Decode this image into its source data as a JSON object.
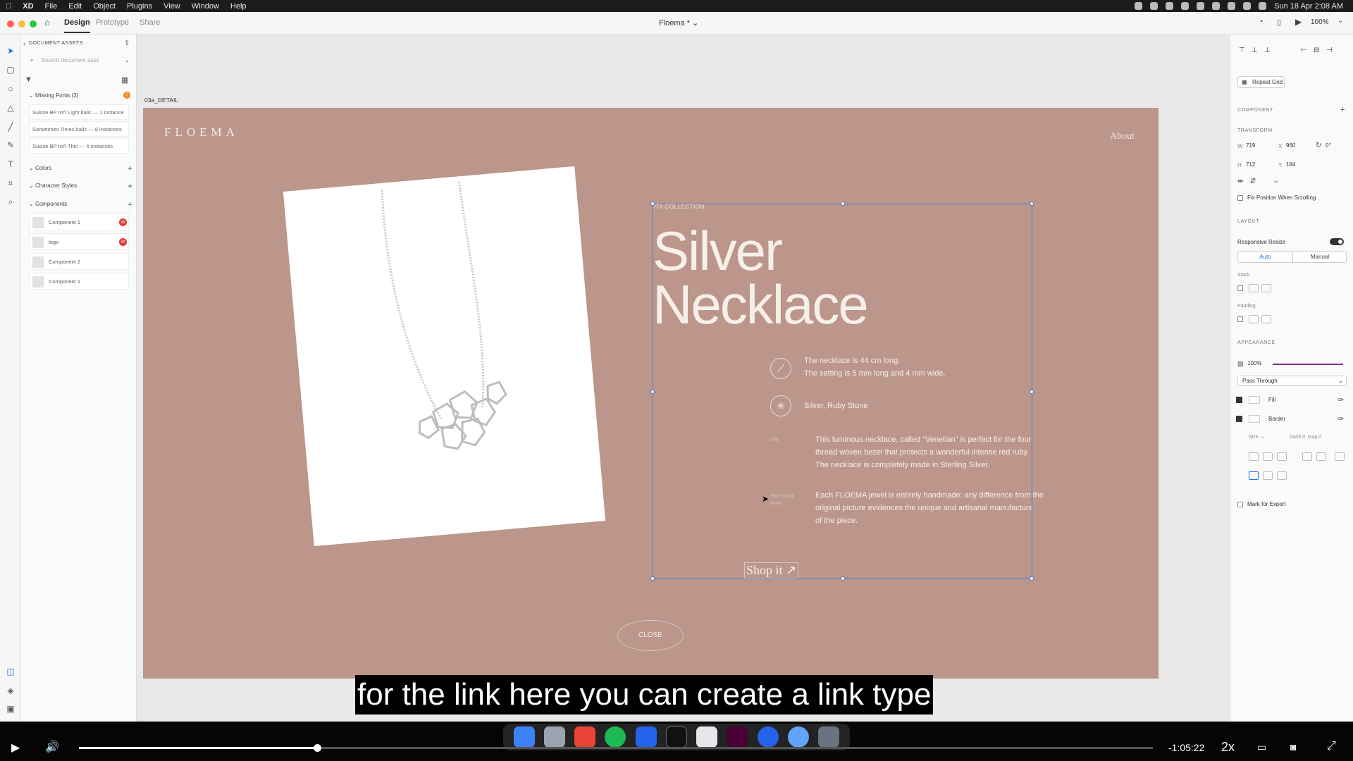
{
  "menubar": {
    "items": [
      "XD",
      "File",
      "Edit",
      "Object",
      "Plugins",
      "View",
      "Window",
      "Help"
    ],
    "datetime": "Sun 18 Apr 2:08 AM"
  },
  "titlebar": {
    "tabs": [
      "Design",
      "Prototype",
      "Share"
    ],
    "active_tab": "Design",
    "document_title": "Floema *",
    "zoom": "100%"
  },
  "assets": {
    "header": "DOCUMENT ASSETS",
    "search_placeholder": "Search document asse",
    "missing_fonts_label": "Missing Fonts (3)",
    "missing_fonts": [
      "Suisse BP Int'l Light Italic — 1 instance",
      "Sometimes Times Italic — 8 instances",
      "Suisse BP Int'l Thin — 4 instances"
    ],
    "sections": {
      "colors": "Colors",
      "character_styles": "Character Styles",
      "components": "Components"
    },
    "components": [
      {
        "name": "Component 1",
        "warning": true
      },
      {
        "name": "logo",
        "warning": true
      },
      {
        "name": "Component 2",
        "warning": false
      },
      {
        "name": "Component 1",
        "warning": false
      }
    ]
  },
  "canvas": {
    "artboard_name": "03a_DETAIL",
    "logo": "FLOEMA",
    "nav_about": "About",
    "collection": "ITA COLLECTION",
    "title_line1": "Silver",
    "title_line2": "Necklace",
    "size_line1": "The necklace is 44 cm long.",
    "size_line2": "The setting is 5 mm long and 4 mm wide.",
    "material": "Silver, Ruby Stone",
    "info_label": "Info",
    "info_lines": [
      "This luminous necklace, called “Venetian” is perfect for the four",
      "thread woven bezel that protects a wonderful intense red ruby.",
      "The necklace is completely made in Sterling Silver."
    ],
    "know_label_1": "You should",
    "know_label_2": "know",
    "know_lines": [
      "Each FLOEMA jewel is entirely handmade: any difference from the",
      "original picture evidences the unique and artisanal manufacture",
      "of the piece."
    ],
    "shop_label": "Shop it ↗",
    "close_label": "CLOSE",
    "background_color": "#bc968a"
  },
  "properties": {
    "repeat_grid": "Repeat Grid",
    "component": "COMPONENT",
    "transform": "TRANSFORM",
    "w_label": "W",
    "w": "719",
    "h_label": "H",
    "h": "712",
    "x_label": "X",
    "x": "960",
    "y_label": "Y",
    "y": "184",
    "rotation": "0°",
    "fix_position": "Fix Position When Scrolling",
    "layout": "LAYOUT",
    "responsive_resize": "Responsive Resize",
    "auto": "Auto",
    "manual": "Manual",
    "stack": "Stack",
    "padding": "Padding",
    "appearance": "APPEARANCE",
    "opacity": "100%",
    "blend_mode": "Pass Through",
    "fill": "Fill",
    "border": "Border",
    "size_label": "Size —",
    "dash_label": "Dash 0",
    "gap_label": "Gap 0",
    "mark_for_export": "Mark for Export"
  },
  "subtitle": "for the link here you can create a link type",
  "player": {
    "time_remaining": "-1:05:22",
    "speed": "2x",
    "progress": 0.222
  }
}
